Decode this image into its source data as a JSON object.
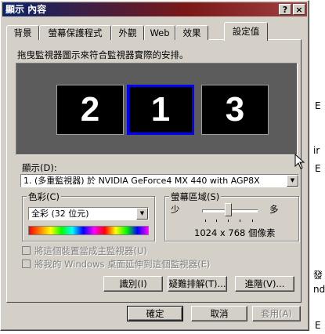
{
  "window": {
    "title": "顯示 內容",
    "help_glyph": "?",
    "close_glyph": "×"
  },
  "tabs": [
    "背景",
    "螢幕保護程式",
    "外觀",
    "Web",
    "效果",
    "設定值"
  ],
  "active_tab": "設定值",
  "instruction": "拖曳監視器圖示來符合監視器實際的安排。",
  "monitors": [
    "2",
    "1",
    "3"
  ],
  "display": {
    "label": "顯示(D):",
    "value": "1. (多重監視器) 於 NVIDIA GeForce4 MX 440 with AGP8X"
  },
  "colors": {
    "label": "色彩(C)",
    "value": "全彩 (32 位元)"
  },
  "screen_area": {
    "label": "螢幕區域(S)",
    "less": "少",
    "more": "多",
    "resolution": "1024 x 768 個像素",
    "slider_fraction": 0.45
  },
  "checkboxes": [
    {
      "label": "將這個裝置當成主監視器(U)",
      "checked": false,
      "enabled": false
    },
    {
      "label": "將我的 Windows 桌面延伸到這個監視器(E)",
      "checked": false,
      "enabled": false
    }
  ],
  "buttons": {
    "identify": "識別(I)",
    "troubleshoot": "疑難排解(T)...",
    "advanced": "進階(V)..."
  },
  "footer": {
    "ok": "確定",
    "cancel": "取消",
    "apply": "套用(A)"
  },
  "background_chars": [
    "E",
    "ir",
    "E",
    "發",
    "nd",
    "E"
  ]
}
